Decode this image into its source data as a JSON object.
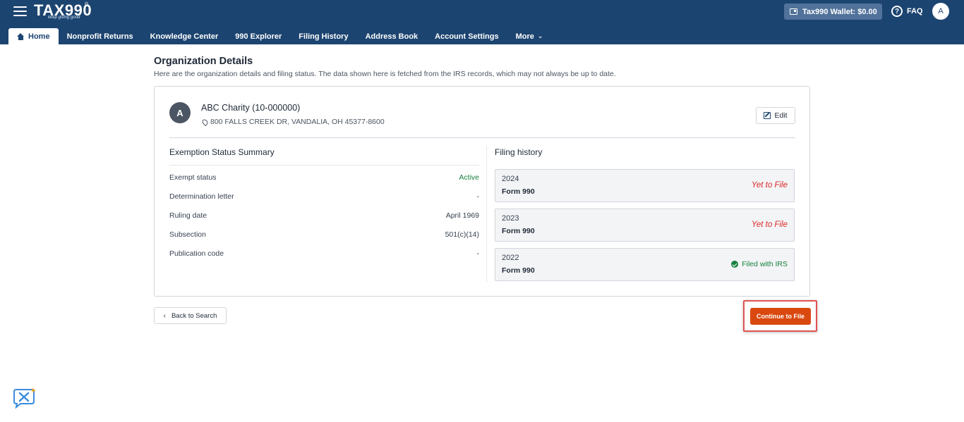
{
  "header": {
    "logo_text": "TAX990",
    "logo_tagline": "keep giving good",
    "wallet_label": "Tax990 Wallet: $0.00",
    "faq_label": "FAQ",
    "user_initial": "A"
  },
  "nav": {
    "items": [
      {
        "label": "Home",
        "active": true
      },
      {
        "label": "Nonprofit Returns"
      },
      {
        "label": "Knowledge Center"
      },
      {
        "label": "990 Explorer"
      },
      {
        "label": "Filing History"
      },
      {
        "label": "Address Book"
      },
      {
        "label": "Account Settings"
      },
      {
        "label": "More"
      }
    ]
  },
  "page": {
    "title": "Organization Details",
    "subtitle": "Here are the organization details and filing status. The data shown here is fetched from the IRS records, which may not always be up to date."
  },
  "organization": {
    "initial": "A",
    "name": "ABC Charity (10-000000)",
    "address": "800 FALLS CREEK DR, VANDALIA, OH 45377-8600",
    "edit_label": "Edit"
  },
  "exemption": {
    "title": "Exemption Status Summary",
    "rows": [
      {
        "label": "Exempt status",
        "value": "Active"
      },
      {
        "label": "Determination letter",
        "value": "-"
      },
      {
        "label": "Ruling date",
        "value": "April 1969"
      },
      {
        "label": "Subsection",
        "value": "501(c)(14)"
      },
      {
        "label": "Publication code",
        "value": "-"
      }
    ]
  },
  "filing_history": {
    "title": "Filing history",
    "items": [
      {
        "year": "2024",
        "form": "Form 990",
        "status": "Yet to File"
      },
      {
        "year": "2023",
        "form": "Form 990",
        "status": "Yet to File"
      },
      {
        "year": "2022",
        "form": "Form 990",
        "status": "Filed with IRS"
      }
    ]
  },
  "actions": {
    "back_label": "Back to Search",
    "continue_label": "Continue to File"
  },
  "colors": {
    "header_bg": "#1c4470",
    "accent_orange": "#d9480f",
    "status_active": "#15803d",
    "status_pending": "#dc2626"
  }
}
